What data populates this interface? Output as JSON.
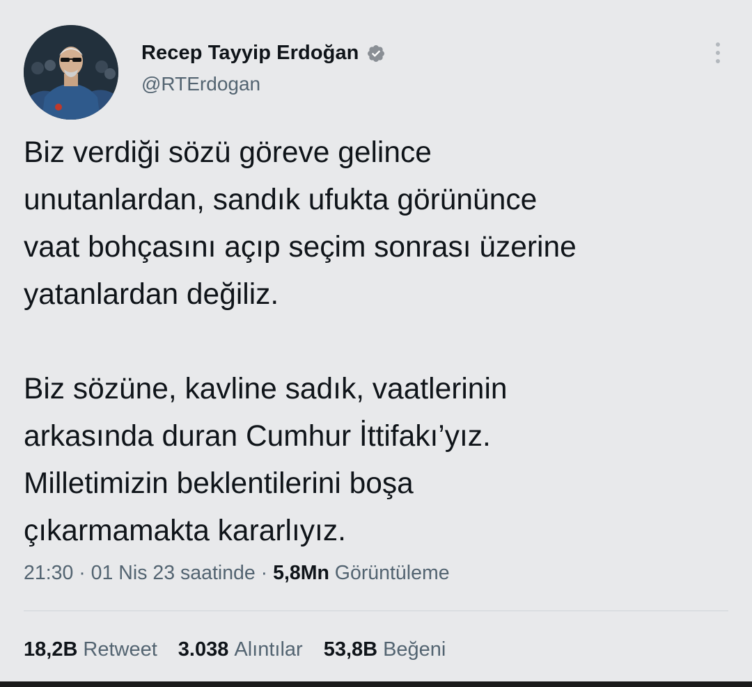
{
  "author": {
    "display_name": "Recep Tayyip Erdoğan",
    "handle": "@RTErdogan",
    "verified_icon": "verified-badge-icon",
    "avatar_icon": "avatar"
  },
  "menu_icon": "more-options-icon",
  "tweet": {
    "text": "Biz verdiği sözü göreve gelince\nunutanlardan, sandık ufukta görününce\nvaat bohçasını açıp seçim sonrası üzerine\nyatanlardan değiliz.\n\nBiz sözüne, kavline sadık, vaatlerinin\narkasında duran Cumhur İttifakı’yız.\nMilletimizin beklentilerini boşa\nçıkarmamakta kararlıyız."
  },
  "meta": {
    "time": "21:30",
    "separator": "·",
    "date": "01 Nis 23 saatinde",
    "views_count": "5,8Mn",
    "views_label": "Görüntüleme"
  },
  "stats": [
    {
      "count": "18,2B",
      "label": "Retweet"
    },
    {
      "count": "3.038",
      "label": "Alıntılar"
    },
    {
      "count": "53,8B",
      "label": "Beğeni"
    }
  ],
  "colors": {
    "background": "#e8e9eb",
    "primary_text": "#0f1419",
    "secondary_text": "#536471",
    "verified": "#8a8f95"
  }
}
